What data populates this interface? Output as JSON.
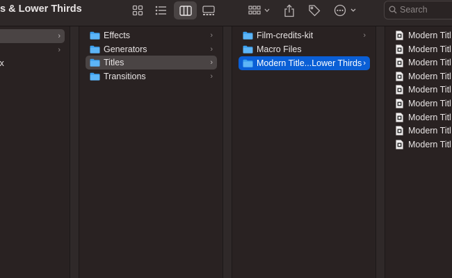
{
  "window": {
    "title": "s & Lower Thirds"
  },
  "toolbar": {
    "view_icons": [
      "grid-view-icon",
      "list-view-icon",
      "column-view-icon",
      "gallery-view-icon"
    ],
    "active_view": "column-view-icon",
    "group_icon": "group-by-icon",
    "share_icon": "share-icon",
    "tag_icon": "tag-icon",
    "more_icon": "more-actions-icon",
    "search_placeholder": "Search"
  },
  "column1": {
    "items": [
      {
        "label": "",
        "selected": "gray",
        "chevron": true
      },
      {
        "label": "",
        "selected": "",
        "chevron": true
      },
      {
        "label": "fx",
        "selected": "",
        "chevron": false
      }
    ]
  },
  "column2": {
    "items": [
      {
        "label": "Effects",
        "selected": ""
      },
      {
        "label": "Generators",
        "selected": ""
      },
      {
        "label": "Titles",
        "selected": "gray"
      },
      {
        "label": "Transitions",
        "selected": ""
      }
    ]
  },
  "column3": {
    "items": [
      {
        "label": "Film-credits-kit",
        "selected": ""
      },
      {
        "label": "Macro Files",
        "selected": ""
      },
      {
        "label": "Modern Title...Lower Thirds",
        "selected": "blue"
      }
    ]
  },
  "column4": {
    "items": [
      {
        "label": "Modern Titl"
      },
      {
        "label": "Modern Titl"
      },
      {
        "label": "Modern Titl"
      },
      {
        "label": "Modern Titl"
      },
      {
        "label": "Modern Titl"
      },
      {
        "label": "Modern Titl"
      },
      {
        "label": "Modern Titl"
      },
      {
        "label": "Modern Titl"
      },
      {
        "label": "Modern Titl"
      }
    ]
  },
  "colors": {
    "selection_blue": "#0a5fd6",
    "folder_blue": "#3aa0f0"
  }
}
